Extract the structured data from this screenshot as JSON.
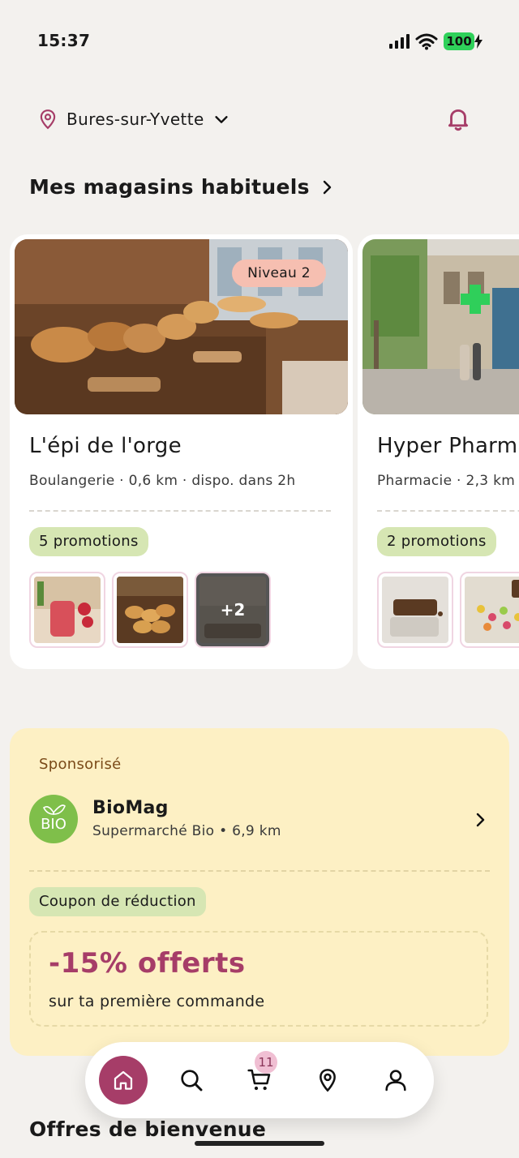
{
  "status_bar": {
    "time": "15:37",
    "battery": "100"
  },
  "header": {
    "location": "Bures-sur-Yvette"
  },
  "section": {
    "title": "Mes magasins habituels"
  },
  "stores": [
    {
      "name": "L'épi de l'orge",
      "meta": "Boulangerie  ·  0,6 km  ·  dispo. dans 2h",
      "badge": "Niveau 2",
      "promotions": "5 promotions",
      "more_count": "+2"
    },
    {
      "name": "Hyper Pharmacie",
      "meta": "Pharmacie  ·  2,3 km",
      "promotions": "2 promotions"
    }
  ],
  "sponsored": {
    "label": "Sponsorisé",
    "logo_text": "BIO",
    "store_name": "BioMag",
    "store_sub": "Supermarché Bio • 6,9 km",
    "coupon_label": "Coupon de réduction",
    "discount": "-15% offerts",
    "discount_sub": "sur ta première commande"
  },
  "next_section": {
    "title": "Offres de bienvenue"
  },
  "bottom_nav": {
    "items": [
      "home-icon",
      "search-icon",
      "cart-icon",
      "map-pin-icon",
      "user-icon"
    ],
    "cart_count": "11"
  },
  "colors": {
    "accent": "#a63d68",
    "promo_pill": "#d6e6b3",
    "sponsor_bg": "#fdf0c4",
    "battery": "#2fd15a"
  }
}
